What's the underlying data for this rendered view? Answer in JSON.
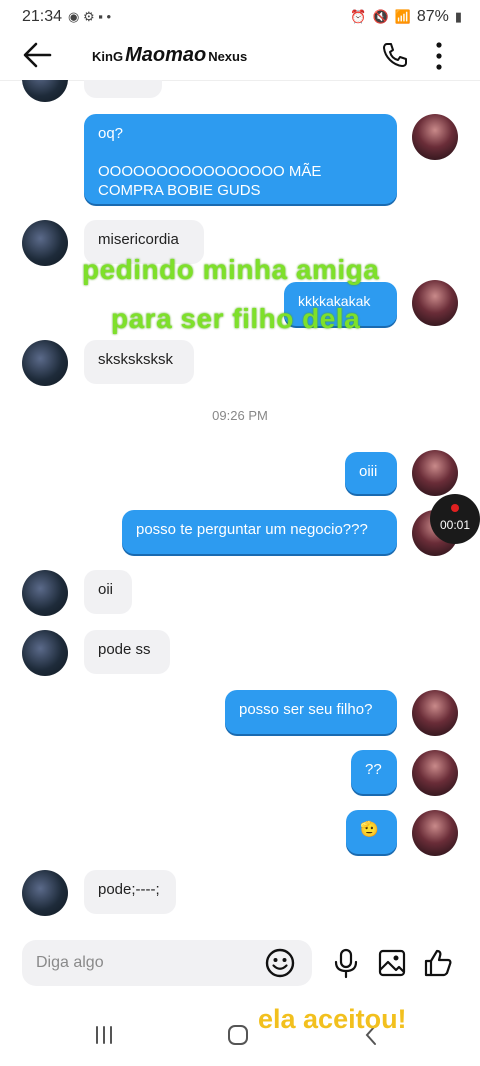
{
  "status_bar": {
    "time": "21:34",
    "battery": "87%"
  },
  "header": {
    "title_prefix": "KinG",
    "title_main": "Maomao",
    "title_suffix": "Nexus"
  },
  "messages": {
    "m_top_partial": "",
    "m1_line1": "oq?",
    "m1_line2": "OOOOOOOOOOOOOOOO MÃE COMPRA BOBIE GUDS",
    "m2": "misericordia",
    "m3": "kkkkakakak",
    "m4": "sksksksksk",
    "time_divider": "09:26 PM",
    "m5": "oiii",
    "m6": "posso te perguntar um negocio???",
    "m7": "oii",
    "m8": "pode ss",
    "m9": "posso ser seu filho?",
    "m10": "??",
    "m11": "🫡",
    "m12": "pode;----;"
  },
  "overlay": {
    "line1": "pedindo minha amiga",
    "line2": "para ser filho dela",
    "bottom": "ela aceitou!"
  },
  "recording": {
    "time": "00:01"
  },
  "composer": {
    "placeholder": "Diga algo"
  },
  "colors": {
    "outgoing": "#2d9bf0",
    "incoming": "#f1f1f3",
    "overlay_green": "#7ee02a",
    "overlay_yellow": "#f2c01e"
  }
}
